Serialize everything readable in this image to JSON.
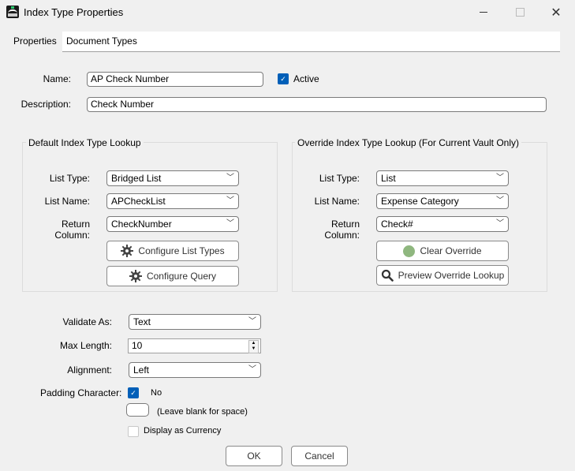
{
  "window": {
    "title": "Index Type Properties",
    "icon": "app-logo-icon",
    "controls": {
      "minimize": "minimize-icon",
      "maximize": "maximize-icon",
      "close": "close-icon",
      "close_glyph": "✕"
    }
  },
  "tabs": [
    {
      "label": "Properties",
      "active": true
    },
    {
      "label": "Document Types",
      "active": false
    }
  ],
  "general": {
    "name_label": "Name:",
    "name_value": "AP Check Number",
    "active_label": "Active",
    "active_checked": true,
    "description_label": "Description:",
    "description_value": "Check Number"
  },
  "default_lookup": {
    "title": "Default Index Type Lookup",
    "list_type_label": "List Type:",
    "list_type_value": "Bridged List",
    "list_name_label": "List Name:",
    "list_name_value": "APCheckList",
    "return_column_label": "Return Column:",
    "return_column_value": "CheckNumber",
    "configure_list_types_label": "Configure List Types",
    "configure_query_label": "Configure Query"
  },
  "override_lookup": {
    "title": "Override Index Type Lookup (For Current Vault Only)",
    "list_type_label": "List Type:",
    "list_type_value": "List",
    "list_name_label": "List Name:",
    "list_name_value": "Expense Category",
    "return_column_label": "Return Column:",
    "return_column_value": "Check#",
    "clear_override_label": "Clear Override",
    "clear_override_color": "#8fb77f",
    "preview_override_label": "Preview Override Lookup"
  },
  "validation": {
    "validate_as_label": "Validate As:",
    "validate_as_value": "Text",
    "max_length_label": "Max Length:",
    "max_length_value": "10",
    "alignment_label": "Alignment:",
    "alignment_value": "Left",
    "padding_label": "Padding Character:",
    "padding_no_label": "No",
    "padding_no_checked": true,
    "padding_char_value": "",
    "padding_hint": "(Leave blank for space)",
    "currency_label": "Display as Currency",
    "currency_checked": false
  },
  "footer": {
    "ok_label": "OK",
    "cancel_label": "Cancel"
  },
  "colors": {
    "accent": "#005fb8",
    "background": "#f0f0f0"
  }
}
